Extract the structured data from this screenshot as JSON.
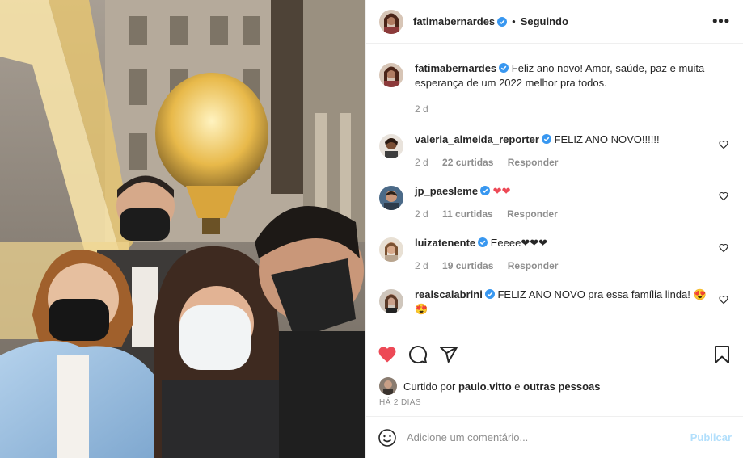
{
  "header": {
    "username": "fatimabernardes",
    "separator": "•",
    "follow_status": "Seguindo",
    "more": "•••"
  },
  "caption": {
    "username": "fatimabernardes",
    "text": "Feliz ano novo! Amor, saúde, paz e muita esperança de um 2022 melhor pra todos.",
    "time": "2 d"
  },
  "comments": [
    {
      "username": "valeria_almeida_reporter",
      "text": "FELIZ ANO NOVO!!!!!!",
      "time": "2 d",
      "likes": "22 curtidas",
      "reply": "Responder"
    },
    {
      "username": "jp_paesleme",
      "text": "❤❤",
      "time": "2 d",
      "likes": "11 curtidas",
      "reply": "Responder"
    },
    {
      "username": "luizatenente",
      "text": "Eeeee❤❤❤",
      "time": "2 d",
      "likes": "19 curtidas",
      "reply": "Responder"
    },
    {
      "username": "realscalabrini",
      "text": "FELIZ ANO NOVO pra essa família linda! 😍😍"
    }
  ],
  "liked_by": {
    "prefix": "Curtido por ",
    "user": "paulo.vitto",
    "connector": " e ",
    "others": "outras pessoas"
  },
  "date": "HÁ 2 DIAS",
  "add_comment": {
    "placeholder": "Adicione um comentário...",
    "publish": "Publicar"
  },
  "colors": {
    "like_red": "#ed4956",
    "verified_blue": "#3897f0",
    "publish_disabled": "#b2dffc",
    "muted": "#8e8e8e"
  },
  "icons": [
    "heart-filled-icon",
    "comment-icon",
    "share-icon",
    "bookmark-icon",
    "emoji-icon",
    "verified-icon",
    "heart-outline-icon"
  ]
}
